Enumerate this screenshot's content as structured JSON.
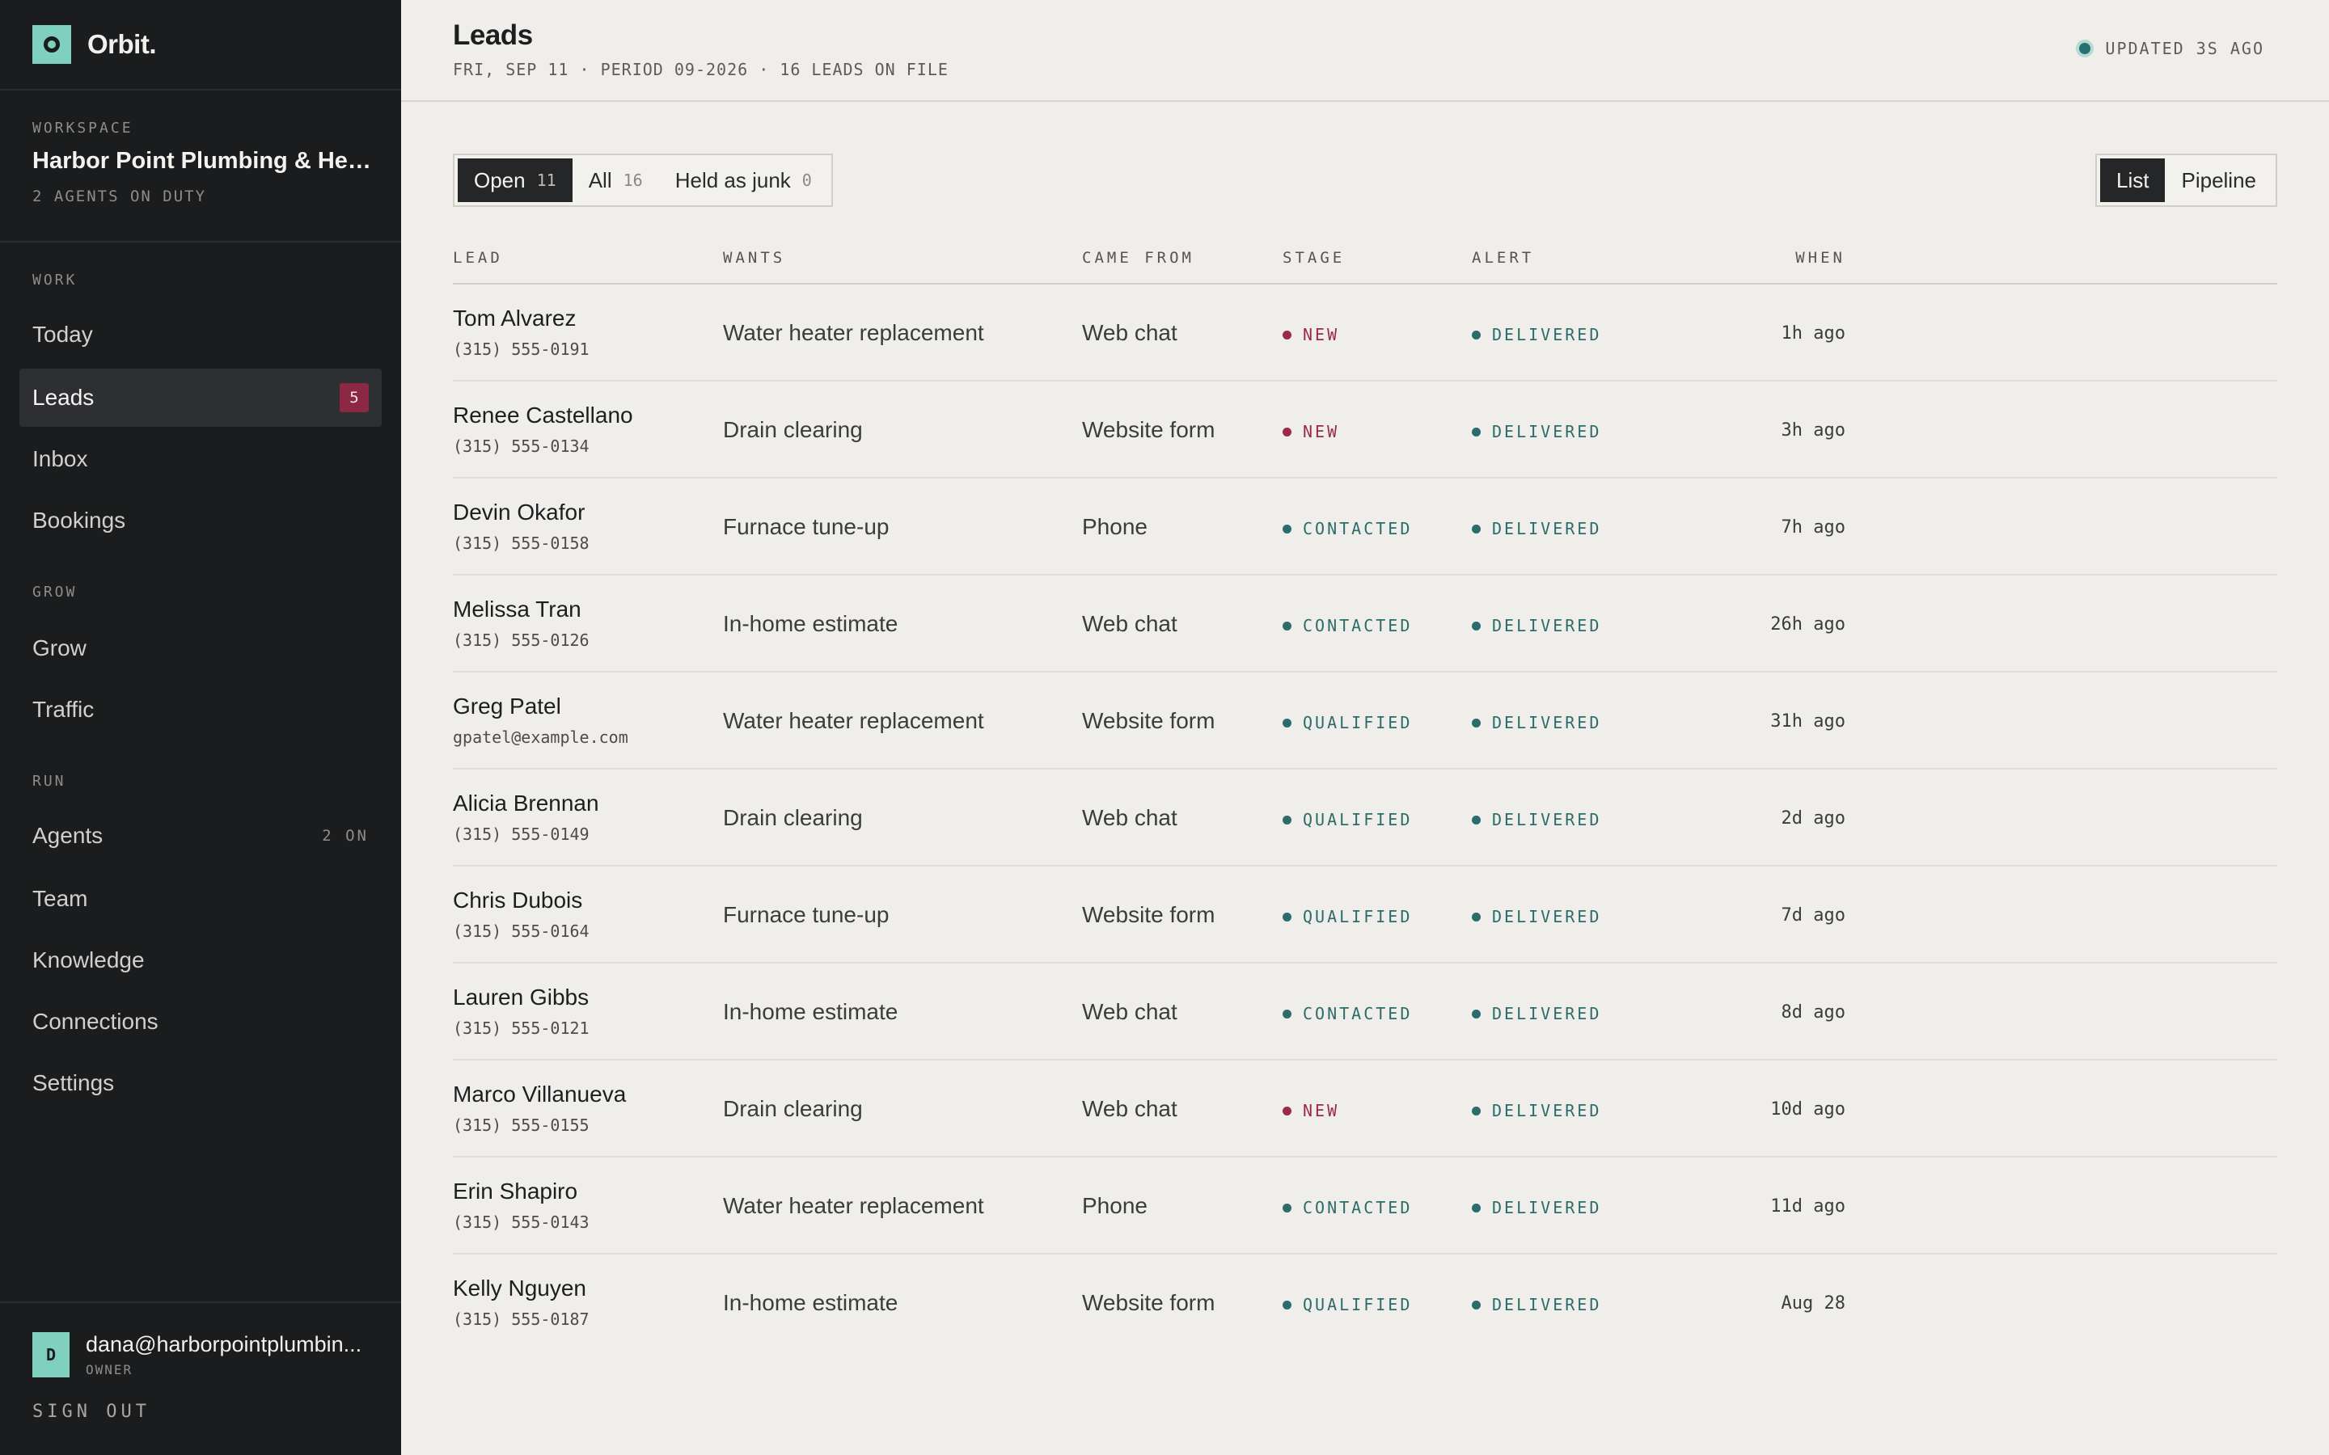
{
  "brand": {
    "name": "Orbit."
  },
  "workspace": {
    "label": "WORKSPACE",
    "name": "Harbor Point Plumbing & Heat...",
    "agents": "2 AGENTS ON DUTY"
  },
  "nav": {
    "work_label": "WORK",
    "today": "Today",
    "leads": "Leads",
    "leads_badge": "5",
    "inbox": "Inbox",
    "bookings": "Bookings",
    "grow_label": "GROW",
    "grow": "Grow",
    "traffic": "Traffic",
    "run_label": "RUN",
    "agents": "Agents",
    "agents_meta": "2 ON",
    "team": "Team",
    "knowledge": "Knowledge",
    "connections": "Connections",
    "settings": "Settings"
  },
  "user": {
    "initial": "D",
    "email": "dana@harborpointplumbin...",
    "role": "OWNER",
    "signout": "SIGN OUT"
  },
  "header": {
    "title": "Leads",
    "subtitle": "FRI, SEP 11 · PERIOD 09-2026 · 16 LEADS ON FILE",
    "updated": "UPDATED 3S AGO"
  },
  "filters": [
    {
      "label": "Open",
      "count": "11"
    },
    {
      "label": "All",
      "count": "16"
    },
    {
      "label": "Held as junk",
      "count": "0"
    }
  ],
  "views": {
    "list": "List",
    "pipeline": "Pipeline"
  },
  "columns": {
    "lead": "LEAD",
    "wants": "WANTS",
    "came_from": "CAME FROM",
    "stage": "STAGE",
    "alert": "ALERT",
    "when": "WHEN"
  },
  "colors": {
    "new": "#9a2a45",
    "teal": "#2c6b69",
    "accent": "#7fd0bf"
  },
  "rows": [
    {
      "name": "Tom Alvarez",
      "contact": "(315) 555-0191",
      "wants": "Water heater replacement",
      "source": "Web chat",
      "stage": "NEW",
      "alert": "DELIVERED",
      "when": "1h ago"
    },
    {
      "name": "Renee Castellano",
      "contact": "(315) 555-0134",
      "wants": "Drain clearing",
      "source": "Website form",
      "stage": "NEW",
      "alert": "DELIVERED",
      "when": "3h ago"
    },
    {
      "name": "Devin Okafor",
      "contact": "(315) 555-0158",
      "wants": "Furnace tune-up",
      "source": "Phone",
      "stage": "CONTACTED",
      "alert": "DELIVERED",
      "when": "7h ago"
    },
    {
      "name": "Melissa Tran",
      "contact": "(315) 555-0126",
      "wants": "In-home estimate",
      "source": "Web chat",
      "stage": "CONTACTED",
      "alert": "DELIVERED",
      "when": "26h ago"
    },
    {
      "name": "Greg Patel",
      "contact": "gpatel@example.com",
      "wants": "Water heater replacement",
      "source": "Website form",
      "stage": "QUALIFIED",
      "alert": "DELIVERED",
      "when": "31h ago"
    },
    {
      "name": "Alicia Brennan",
      "contact": "(315) 555-0149",
      "wants": "Drain clearing",
      "source": "Web chat",
      "stage": "QUALIFIED",
      "alert": "DELIVERED",
      "when": "2d ago"
    },
    {
      "name": "Chris Dubois",
      "contact": "(315) 555-0164",
      "wants": "Furnace tune-up",
      "source": "Website form",
      "stage": "QUALIFIED",
      "alert": "DELIVERED",
      "when": "7d ago"
    },
    {
      "name": "Lauren Gibbs",
      "contact": "(315) 555-0121",
      "wants": "In-home estimate",
      "source": "Web chat",
      "stage": "CONTACTED",
      "alert": "DELIVERED",
      "when": "8d ago"
    },
    {
      "name": "Marco Villanueva",
      "contact": "(315) 555-0155",
      "wants": "Drain clearing",
      "source": "Web chat",
      "stage": "NEW",
      "alert": "DELIVERED",
      "when": "10d ago"
    },
    {
      "name": "Erin Shapiro",
      "contact": "(315) 555-0143",
      "wants": "Water heater replacement",
      "source": "Phone",
      "stage": "CONTACTED",
      "alert": "DELIVERED",
      "when": "11d ago"
    },
    {
      "name": "Kelly Nguyen",
      "contact": "(315) 555-0187",
      "wants": "In-home estimate",
      "source": "Website form",
      "stage": "QUALIFIED",
      "alert": "DELIVERED",
      "when": "Aug 28"
    }
  ]
}
